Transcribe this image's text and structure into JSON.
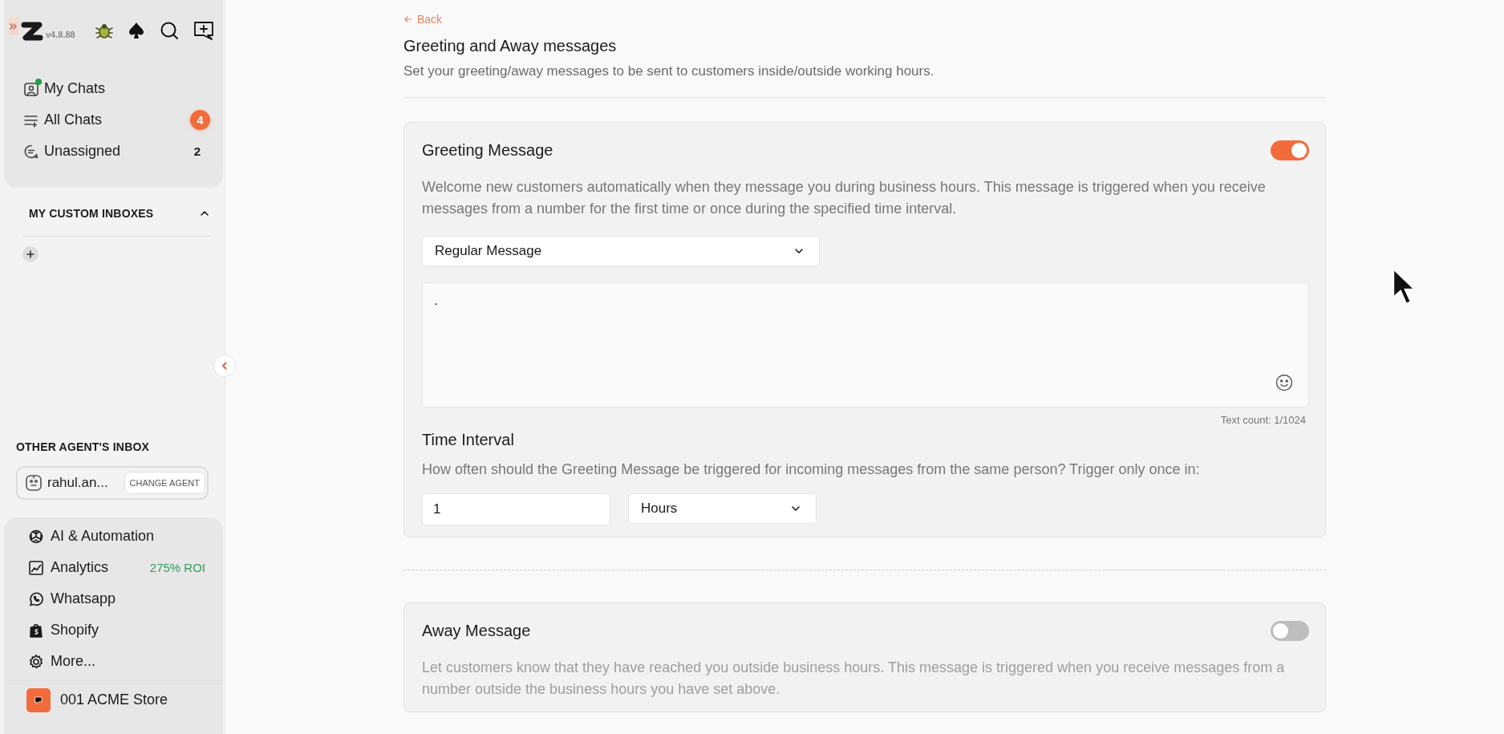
{
  "sidebar": {
    "version": "v4.8.88",
    "chat_nav": [
      {
        "kind": "avatar",
        "label": "My Chats",
        "online": true
      },
      {
        "kind": "list",
        "label": "All Chats",
        "count": "4",
        "highlighted": true,
        "online": false
      },
      {
        "kind": "chat",
        "label": "Unassigned",
        "count": "2",
        "highlighted": false,
        "online": false
      }
    ],
    "custom_inboxes": {
      "title": "MY CUSTOM INBOXES",
      "expanded": true
    },
    "other_agent": {
      "title": "OTHER AGENT'S INBOX",
      "agent": "rahul.an...",
      "button": "CHANGE AGENT"
    },
    "tools_nav": [
      {
        "kind": "ai",
        "label": "AI & Automation"
      },
      {
        "kind": "chart",
        "label": "Analytics",
        "tag": "275% ROI"
      },
      {
        "kind": "whatsapp",
        "label": "Whatsapp"
      },
      {
        "kind": "shopify",
        "label": "Shopify"
      },
      {
        "kind": "gear",
        "label": "More..."
      }
    ],
    "store": "001 ACME Store"
  },
  "main": {
    "back": "Back",
    "title": "Greeting and Away messages",
    "subtitle": "Set your greeting/away messages to be sent to customers inside/outside working hours.",
    "sections": [
      {
        "title": "Greeting Message",
        "enabled": true,
        "description": "Welcome new customers automatically when they message you during business hours. This message is triggered when you receive messages from a number for the first time or once during the specified time interval.",
        "message_type": "Regular Message",
        "message_text": ".",
        "text_count": "Text count: 1/1024",
        "interval_title": "Time Interval",
        "interval_description": "How often should the Greeting Message be triggered for incoming messages from the same person? Trigger only once in:",
        "interval_value": "1",
        "interval_unit": "Hours"
      },
      {
        "title": "Away Message",
        "enabled": false,
        "description": "Let customers know that they have reached you outside business hours. This message is triggered when you receive messages from a number outside the business hours you have set above."
      }
    ]
  }
}
